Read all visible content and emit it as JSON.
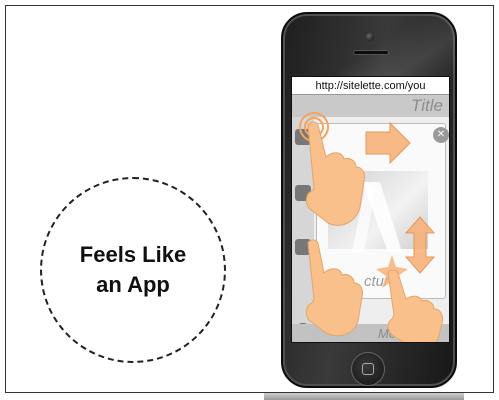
{
  "caption": {
    "line1": "Feels Like",
    "line2": "an App"
  },
  "phone": {
    "url": "http://sitelette.com/you",
    "title": "Title",
    "caption": "cture",
    "footer_label": "Me"
  },
  "icons": {
    "close": "close-x-icon",
    "phone": "phone-icon",
    "tap_gesture": "tap-hand-icon",
    "swipe_right": "arrow-right-icon",
    "scroll_vertical": "arrow-up-down-icon"
  },
  "colors": {
    "gesture_orange": "#f5a35d",
    "skin": "#f9c08b",
    "frame_border": "#333333"
  }
}
